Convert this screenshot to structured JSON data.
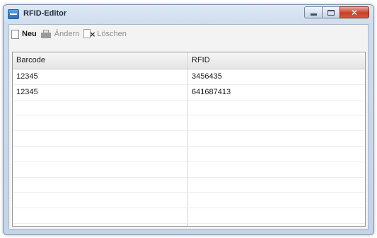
{
  "window": {
    "title": "RFID-Editor",
    "accent_color": "#2d6fb8",
    "controls": {
      "minimize_icon": "minimize-icon",
      "maximize_icon": "maximize-icon",
      "close_icon": "close-icon",
      "close_glyph": "✕"
    }
  },
  "toolbar": {
    "new_label": "Neu",
    "edit_label": "Ändern",
    "delete_label": "Löschen",
    "edit_enabled": false,
    "delete_enabled": false
  },
  "table": {
    "columns": [
      "Barcode",
      "RFID"
    ],
    "rows": [
      [
        "12345",
        "3456435"
      ],
      [
        "12345",
        "641687413"
      ],
      [
        "",
        ""
      ],
      [
        "",
        ""
      ],
      [
        "",
        ""
      ],
      [
        "",
        ""
      ],
      [
        "",
        ""
      ],
      [
        "",
        ""
      ],
      [
        "",
        ""
      ],
      [
        "",
        ""
      ],
      [
        "",
        ""
      ]
    ]
  }
}
